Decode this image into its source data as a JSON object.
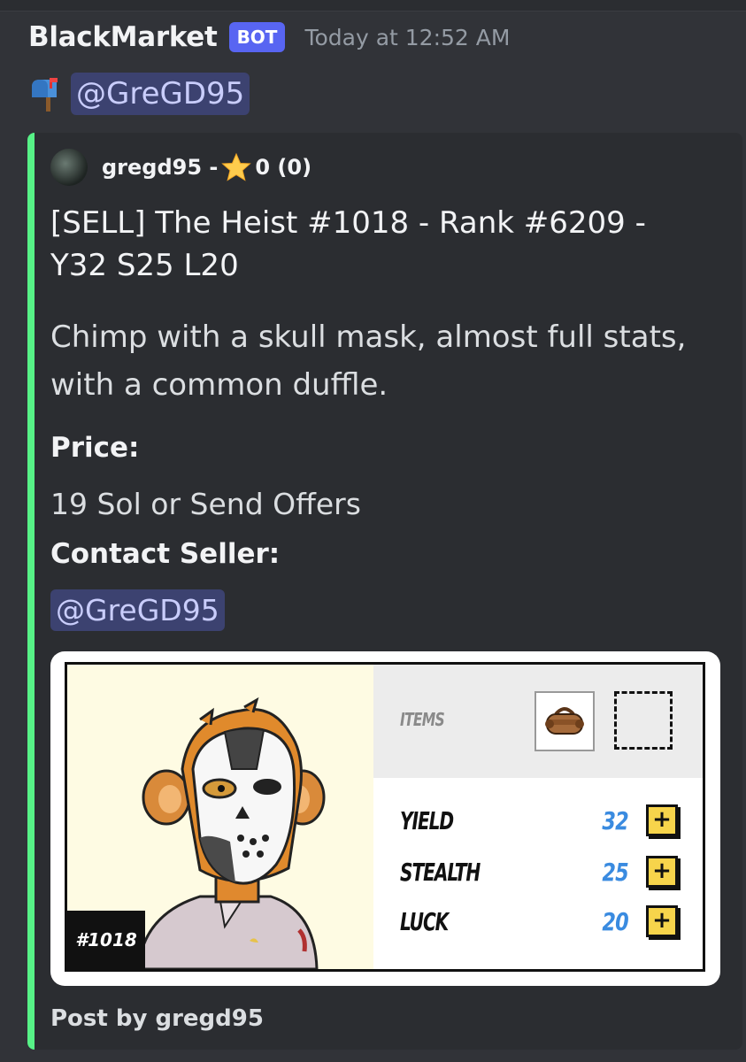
{
  "message": {
    "username": "BlackMarket",
    "badge": "BOT",
    "timestamp": "Today at 12:52 AM",
    "mention": "@GreGD95"
  },
  "embed": {
    "accent_color": "#57f287",
    "author": {
      "name_prefix": "gregd95 -",
      "rating": "0 (0)"
    },
    "title": "[SELL] The Heist #1018 - Rank #6209 - Y32 S25 L20",
    "description": "Chimp with a skull mask, almost full stats, with a common duffle.",
    "fields": [
      {
        "name": "Price:",
        "value": "19 Sol or Send Offers"
      },
      {
        "name": "Contact Seller:",
        "value": "@GreGD95"
      }
    ],
    "footer": "Post by gregd95"
  },
  "card": {
    "token_id": "#1018",
    "items_label": "ITEMS",
    "stats": [
      {
        "label": "YIELD",
        "value": "32"
      },
      {
        "label": "STEALTH",
        "value": "25"
      },
      {
        "label": "LUCK",
        "value": "20"
      }
    ],
    "plus_label": "+"
  },
  "colors": {
    "background": "#313338",
    "embed_bg": "#2b2d31",
    "mention_bg": "#3c4270",
    "mention_text": "#c9cdfb",
    "bot_badge": "#5865f2",
    "stat_value": "#3a8be0",
    "plus_button": "#f7d44b"
  }
}
